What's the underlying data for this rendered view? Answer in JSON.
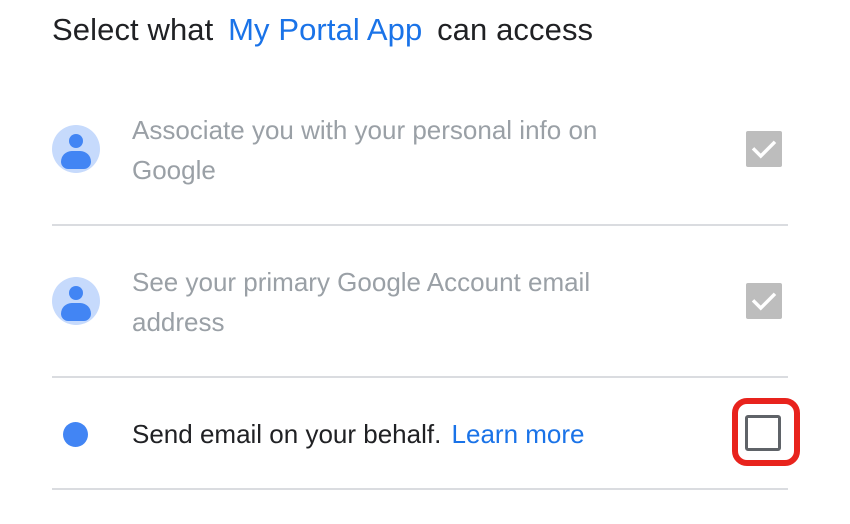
{
  "heading": {
    "prefix": "Select what",
    "app_name": "My Portal App",
    "suffix": "can access"
  },
  "permissions": [
    {
      "text": "Associate you with your personal info on Google",
      "checked": true,
      "disabled": true,
      "icon": "account-avatar-icon"
    },
    {
      "text": "See your primary Google Account email address",
      "checked": true,
      "disabled": true,
      "icon": "account-avatar-icon"
    },
    {
      "text": "Send email on your behalf.",
      "link": "Learn more",
      "checked": false,
      "disabled": false,
      "icon": "blue-dot-icon"
    }
  ],
  "colors": {
    "accent": "#1a73e8",
    "highlight": "#e8231d",
    "disabled_text": "#9aa0a6",
    "text": "#202124"
  }
}
